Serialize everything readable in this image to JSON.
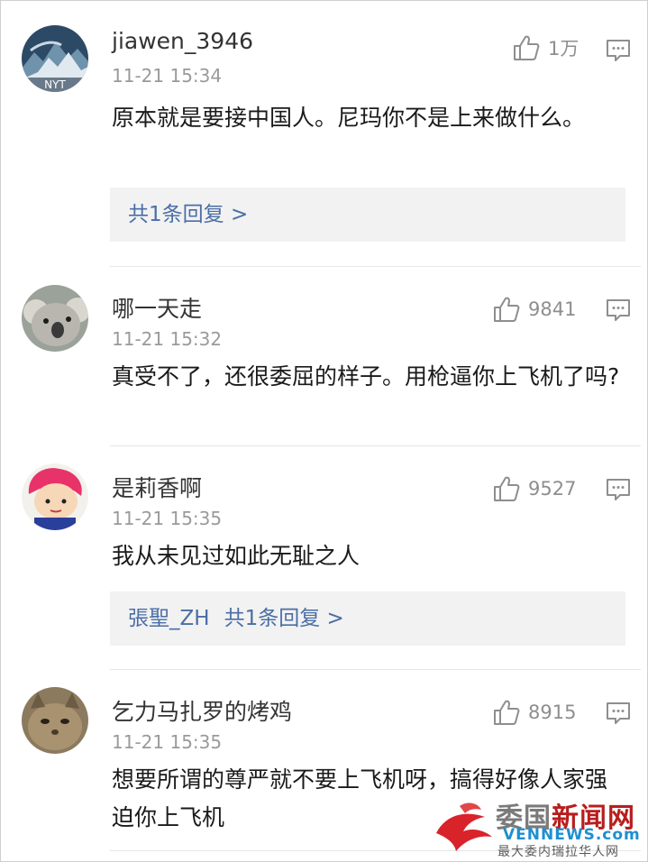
{
  "comments": [
    {
      "username": "jiawen_3946",
      "timestamp": "11-21 15:34",
      "likes": "1万",
      "text": "原本就是要接中国人。尼玛你不是上来做什么。",
      "reply_prefix": "",
      "reply_summary": "共1条回复 >",
      "avatar_icon": "blue-landscape-avatar"
    },
    {
      "username": "哪一天走",
      "timestamp": "11-21 15:32",
      "likes": "9841",
      "text": "真受不了，还很委屈的样子。用枪逼你上飞机了吗?",
      "avatar_icon": "koala-avatar"
    },
    {
      "username": "是莉香啊",
      "timestamp": "11-21 15:35",
      "likes": "9527",
      "text": "我从未见过如此无耻之人",
      "reply_prefix": "張聖_ZH",
      "reply_summary": "共1条回复 >",
      "avatar_icon": "cartoon-boy-avatar"
    },
    {
      "username": "乞力马扎罗的烤鸡",
      "timestamp": "11-21 15:35",
      "likes": "8915",
      "text": "想要所谓的尊严就不要上飞机呀，搞得好像人家强迫你上飞机",
      "avatar_icon": "cat-avatar"
    }
  ],
  "watermark": {
    "title_main": "委国",
    "title_accent": "新闻网",
    "url": "VENNEWS.com",
    "tagline": "最大委内瑞拉华人网"
  },
  "colors": {
    "link": "#4a6ea6",
    "reply_bg": "#f2f2f2",
    "meta_gray": "#9a9a9a",
    "watermark_red": "#b81e1e",
    "watermark_blue": "#1e8fd0"
  }
}
